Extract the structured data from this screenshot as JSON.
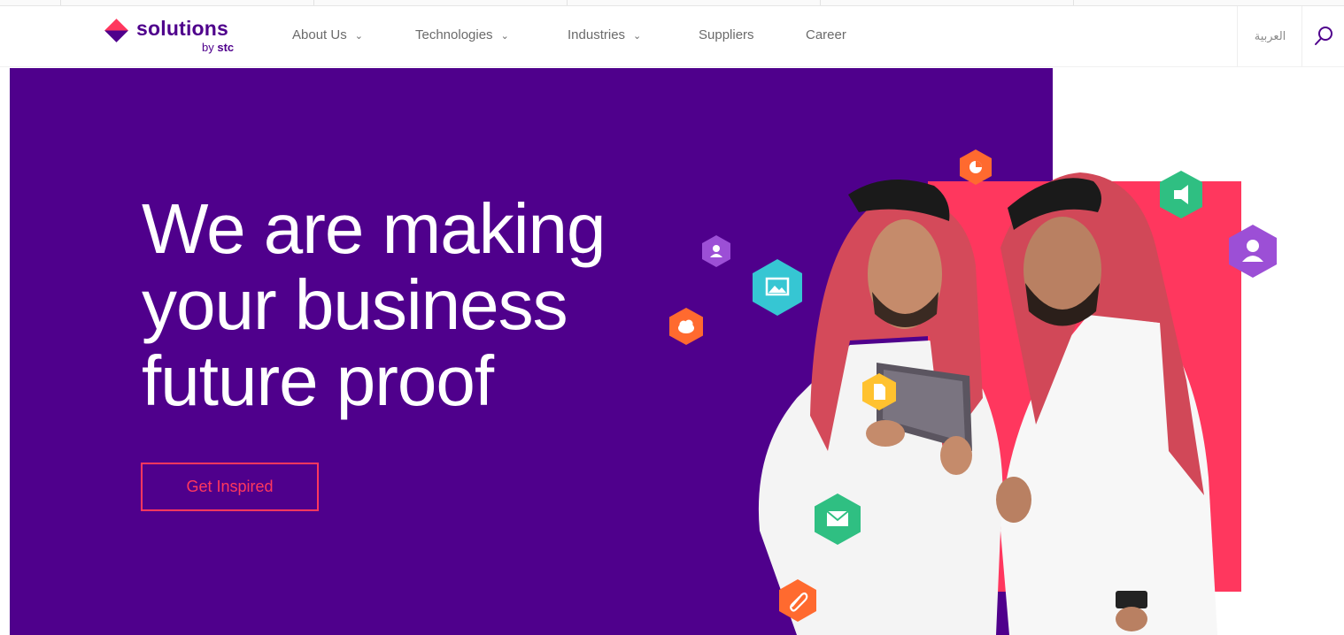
{
  "brand": {
    "name": "solutions",
    "by": "by",
    "company": "stc",
    "colors": {
      "primary": "#4f008c",
      "accent": "#ff375e"
    }
  },
  "nav": {
    "items": [
      {
        "label": "About Us",
        "dropdown": true
      },
      {
        "label": "Technologies",
        "dropdown": true
      },
      {
        "label": "Industries",
        "dropdown": true
      },
      {
        "label": "Suppliers",
        "dropdown": false
      },
      {
        "label": "Career",
        "dropdown": false
      }
    ],
    "chevron_icon": "chevron-down-icon"
  },
  "header": {
    "language_label": "العربية",
    "search_icon": "search-icon"
  },
  "hero": {
    "headline_lines": [
      "We are making",
      "your business",
      "future proof"
    ],
    "cta_label": "Get Inspired",
    "icons": [
      {
        "name": "chart-icon",
        "color": "#ff6a2f"
      },
      {
        "name": "megaphone-icon",
        "color": "#2fbf82"
      },
      {
        "name": "user-icon",
        "color": "#9c4fd6"
      },
      {
        "name": "image-icon",
        "color": "#36c6d3"
      },
      {
        "name": "cloud-icon",
        "color": "#ff6a2f"
      },
      {
        "name": "document-icon",
        "color": "#ffc22f"
      },
      {
        "name": "mail-icon",
        "color": "#2fbf82"
      },
      {
        "name": "paperclip-icon",
        "color": "#ff6a2f"
      }
    ]
  }
}
